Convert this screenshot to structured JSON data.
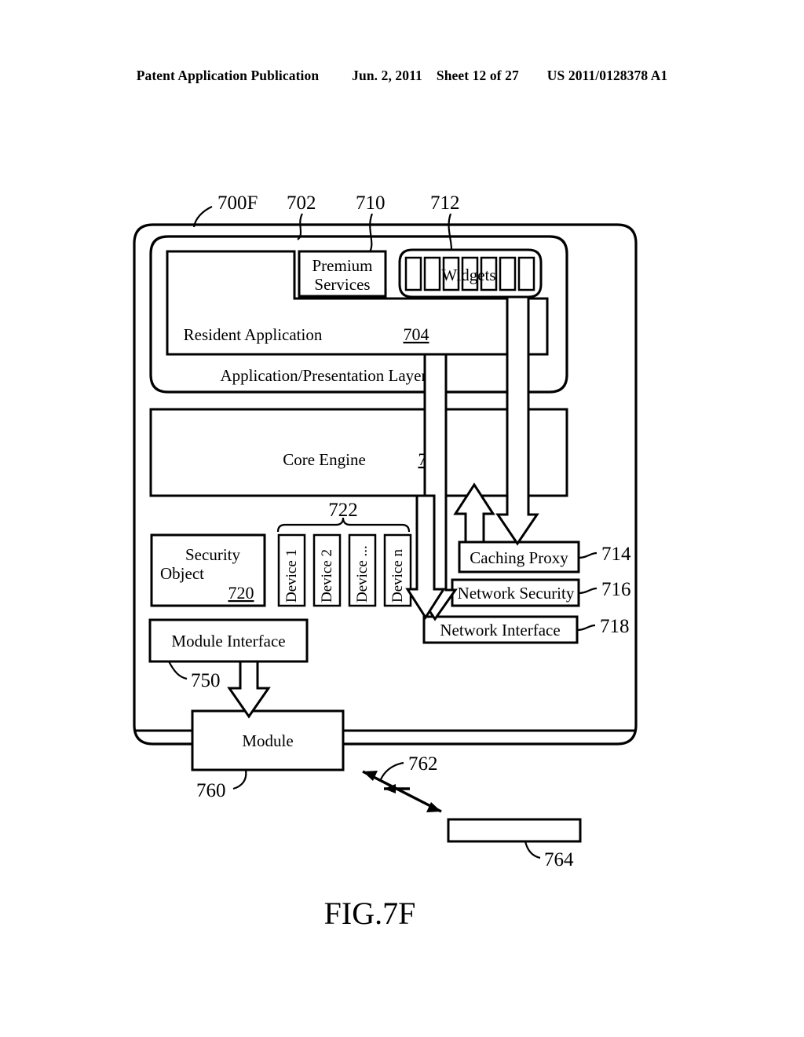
{
  "header": {
    "publication": "Patent Application Publication",
    "date": "Jun. 2, 2011",
    "sheet": "Sheet 12 of 27",
    "docnum": "US 2011/0128378 A1"
  },
  "figure": {
    "caption": "FIG.7F"
  },
  "boxes": {
    "premium_services_line1": "Premium",
    "premium_services_line2": "Services",
    "widgets": "Widgets",
    "resident_application": "Resident Application",
    "resident_application_ref": "704",
    "app_presentation_layer": "Application/Presentation Layer",
    "core_engine": "Core Engine",
    "core_engine_ref": "706",
    "security_object_line1": "Security",
    "security_object_line2": "Object",
    "security_object_ref": "720",
    "caching_proxy": "Caching Proxy",
    "network_security": "Network Security",
    "network_interface": "Network Interface",
    "module_interface": "Module Interface",
    "module": "Module"
  },
  "devices": [
    {
      "label": "Device 1"
    },
    {
      "label": "Device 2"
    },
    {
      "label": "Device ..."
    },
    {
      "label": "Device n"
    }
  ],
  "reference_numerals": {
    "system": "700F",
    "inner_layer": "702",
    "premium_services": "710",
    "widgets": "712",
    "caching_proxy": "714",
    "network_security": "716",
    "network_interface": "718",
    "device_group": "722",
    "module_interface": "750",
    "module": "760",
    "link": "762",
    "external_device": "764"
  },
  "colors": {
    "ink": "#000000",
    "paper": "#ffffff"
  }
}
